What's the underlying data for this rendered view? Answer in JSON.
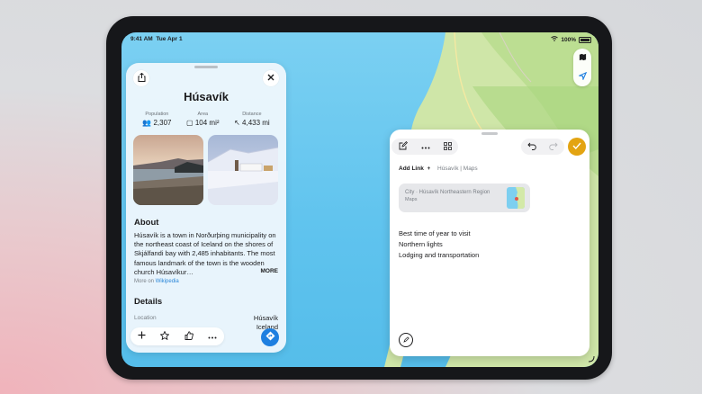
{
  "status_bar": {
    "time": "9:41 AM",
    "date": "Tue Apr 1",
    "battery": "100%",
    "wifi_icon": "wifi-icon"
  },
  "map_controls": {
    "map_icon": "map-icon",
    "location_icon": "location-arrow-icon"
  },
  "place_card": {
    "title": "Húsavík",
    "share_icon": "share-icon",
    "close_icon": "close-icon",
    "stats": [
      {
        "label": "Population",
        "value": "2,307",
        "icon": "people-icon"
      },
      {
        "label": "Area",
        "value": "104 mi²",
        "icon": "square-icon"
      },
      {
        "label": "Distance",
        "value": "4,433 mi",
        "icon": "distance-arrow-icon"
      }
    ],
    "about": {
      "heading": "About",
      "text": "Húsavík is a town in Norðurþing municipality on the northeast coast of Iceland on the shores of Skjálfandi bay with 2,485 inhabitants. The most famous landmark of the town is the wooden church Húsavíkur…",
      "more_label": "MORE",
      "source_prefix": "More on",
      "source_link": "Wikipedia"
    },
    "details": {
      "heading": "Details",
      "location_label": "Location",
      "location_line1": "Húsavík",
      "location_line2": "Iceland"
    },
    "actions": [
      "add-icon",
      "star-icon",
      "thumbs-up-icon",
      "more-icon"
    ],
    "directions_icon": "directions-icon"
  },
  "quick_note": {
    "toolbar_left": [
      "compose-icon",
      "more-icon",
      "grid-icon"
    ],
    "toolbar_right": [
      "undo-icon",
      "redo-icon"
    ],
    "done_icon": "checkmark-icon",
    "add_link_label": "Add Link",
    "link_tag": "Húsavík | Maps",
    "link_card": {
      "title": "City · Húsavík Northeastern Region",
      "source": "Maps"
    },
    "lines": [
      "Best time of year to visit",
      "Northern lights",
      "Lodging and transportation"
    ],
    "pen_icon": "markup-icon"
  },
  "colors": {
    "accent_blue": "#1e7fe0",
    "done_yellow": "#e3a412",
    "water": "#5fc3ee",
    "land": "#cfe6a8"
  }
}
